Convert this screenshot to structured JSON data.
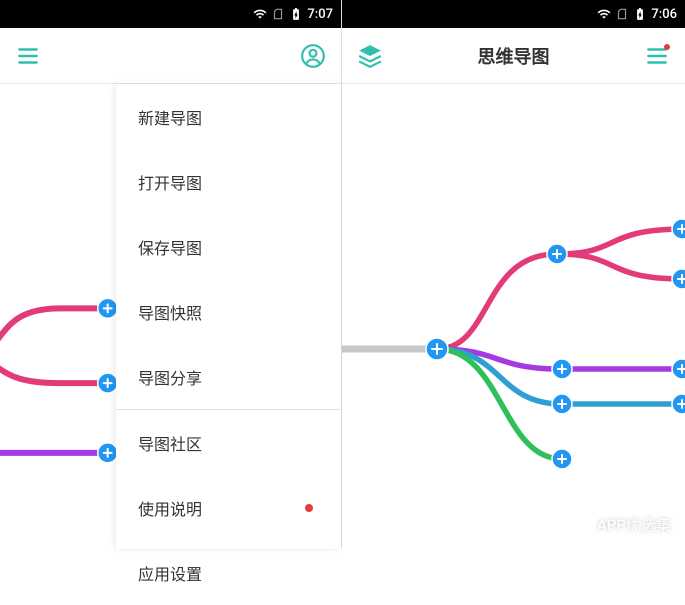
{
  "left": {
    "status": {
      "time": "7:07"
    },
    "menu": {
      "items": [
        "新建导图",
        "打开导图",
        "保存导图",
        "导图快照",
        "导图分享",
        "导图社区",
        "使用说明",
        "应用设置"
      ],
      "divider_after_index": 4,
      "dot_index": 6
    }
  },
  "right": {
    "status": {
      "time": "7:06"
    },
    "title": "思维导图"
  },
  "watermark": "APP优选集",
  "colors": {
    "teal": "#2fbfb0",
    "pink": "#e33a7a",
    "purple": "#a33ae3",
    "blue": "#2f9fd3",
    "green": "#2fbf5b",
    "node": "#2196f3",
    "spine": "#c8c8c8"
  }
}
